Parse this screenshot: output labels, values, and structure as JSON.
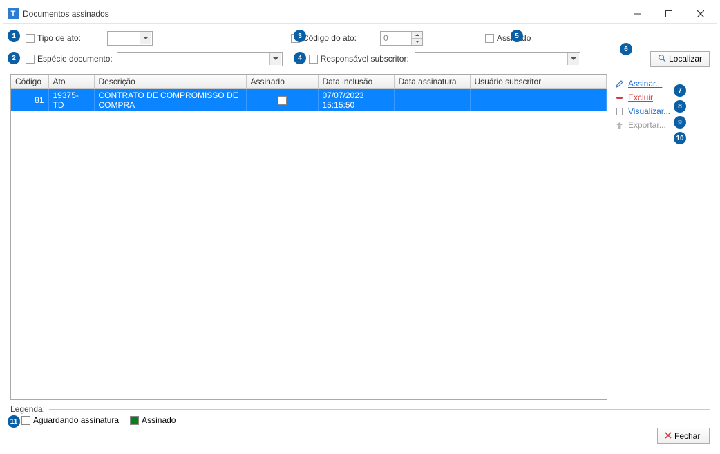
{
  "window": {
    "title": "Documentos assinados",
    "icon_letter": "T"
  },
  "filters": {
    "tipo_ato": {
      "label": "Tipo de ato:",
      "value": ""
    },
    "codigo_ato": {
      "label": "Código do ato:",
      "value": "0"
    },
    "assinado": {
      "label": "Assinado"
    },
    "especie_documento": {
      "label": "Espécie documento:",
      "value": ""
    },
    "responsavel_subscritor": {
      "label": "Responsável subscritor:",
      "value": ""
    }
  },
  "buttons": {
    "localizar": "Localizar",
    "fechar": "Fechar"
  },
  "table": {
    "columns": [
      "Código",
      "Ato",
      "Descrição",
      "Assinado",
      "Data inclusão",
      "Data assinatura",
      "Usuário subscritor"
    ],
    "rows": [
      {
        "codigo": "81",
        "ato": "19375-TD",
        "descricao": "CONTRATO DE COMPROMISSO DE COMPRA",
        "assinado_checked": false,
        "data_inclusao": "07/07/2023 15:15:50",
        "data_assinatura": "",
        "usuario_subscritor": ""
      }
    ]
  },
  "side_actions": {
    "assinar": "Assinar...",
    "excluir": "Excluir",
    "visualizar": "Visualizar...",
    "exportar": "Exportar..."
  },
  "legend": {
    "title": "Legenda:",
    "aguardando": "Aguardando assinatura",
    "assinado": "Assinado",
    "color_aguardando": "#ffffff",
    "color_assinado": "#0a7f1f"
  },
  "badges": [
    "1",
    "2",
    "3",
    "4",
    "5",
    "6",
    "7",
    "8",
    "9",
    "10",
    "11"
  ]
}
